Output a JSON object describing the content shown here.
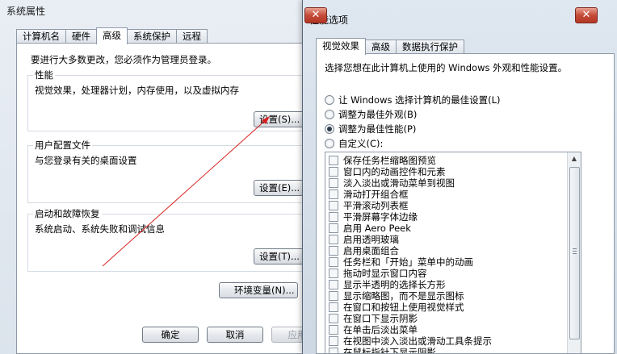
{
  "system_properties": {
    "title": "系统属性",
    "tabs": [
      "计算机名",
      "硬件",
      "高级",
      "系统保护",
      "远程"
    ],
    "active_tab": 2,
    "admin_note": "要进行大多数更改，您必须作为管理员登录。",
    "performance": {
      "title": "性能",
      "description": "视觉效果，处理器计划，内存使用，以及虚拟内存",
      "button": "设置(S)..."
    },
    "user_profiles": {
      "title": "用户配置文件",
      "description": "与您登录有关的桌面设置",
      "button": "设置(E)..."
    },
    "startup_recovery": {
      "title": "启动和故障恢复",
      "description": "系统启动、系统失败和调试信息",
      "button": "设置(T)..."
    },
    "env_button": "环境变量(N)...",
    "ok_button": "确定",
    "cancel_button": "取消",
    "apply_button": "应用"
  },
  "performance_options": {
    "title": "性能选项",
    "close_glyph": "✕",
    "tabs": [
      "视觉效果",
      "高级",
      "数据执行保护"
    ],
    "active_tab": 0,
    "instruction": "选择您想在此计算机上使用的 Windows 外观和性能设置。",
    "radios": [
      {
        "label": "让 Windows 选择计算机的最佳设置(L)",
        "checked": false
      },
      {
        "label": "调整为最佳外观(B)",
        "checked": false
      },
      {
        "label": "调整为最佳性能(P)",
        "checked": true
      },
      {
        "label": "自定义(C):",
        "checked": false
      }
    ],
    "effects": [
      "保存任务栏缩略图预览",
      "窗口内的动画控件和元素",
      "淡入淡出或滑动菜单到视图",
      "滑动打开组合框",
      "平滑滚动列表框",
      "平滑屏幕字体边缘",
      "启用 Aero Peek",
      "启用透明玻璃",
      "启用桌面组合",
      "任务栏和「开始」菜单中的动画",
      "拖动时显示窗口内容",
      "显示半透明的选择长方形",
      "显示缩略图，而不是显示图标",
      "在窗口和按钮上使用视觉样式",
      "在窗口下显示阴影",
      "在单击后淡出菜单",
      "在视图中淡入淡出或滑动工具条提示",
      "在鼠标指针下显示阴影"
    ]
  },
  "colors": {
    "accent_arrow": "#d81e1e",
    "close_button": "#c44b38"
  }
}
